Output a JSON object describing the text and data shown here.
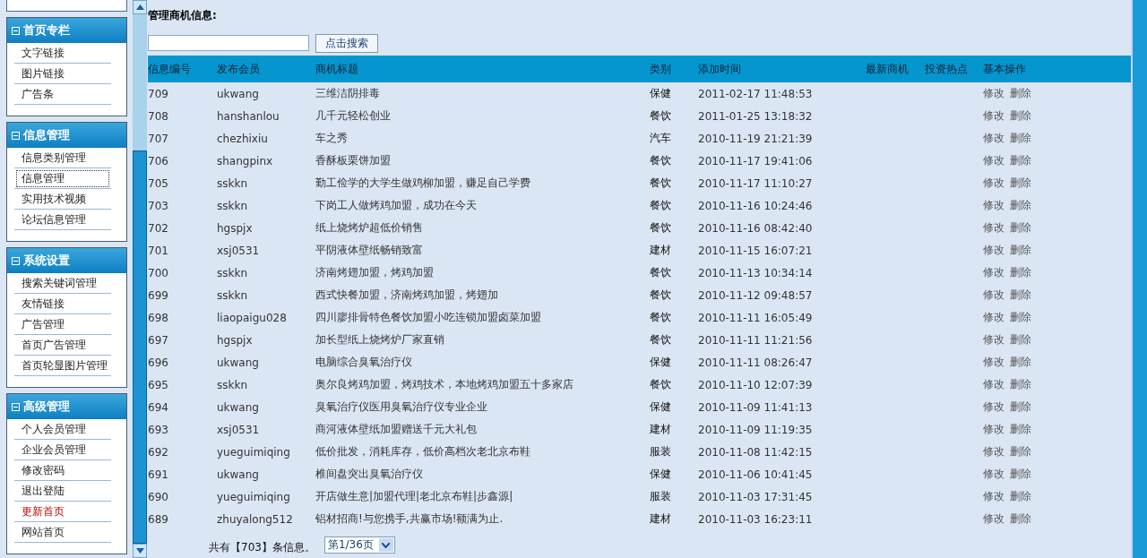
{
  "sidebar": {
    "sections": [
      {
        "title": "首页专栏",
        "items": [
          {
            "label": "文字链接",
            "focused": false,
            "emphasized": false
          },
          {
            "label": "图片链接",
            "focused": false,
            "emphasized": false
          },
          {
            "label": "广告条",
            "focused": false,
            "emphasized": false
          }
        ]
      },
      {
        "title": "信息管理",
        "items": [
          {
            "label": "信息类别管理",
            "focused": false,
            "emphasized": false
          },
          {
            "label": "信息管理",
            "focused": true,
            "emphasized": false
          },
          {
            "label": "实用技术视频",
            "focused": false,
            "emphasized": false
          },
          {
            "label": "论坛信息管理",
            "focused": false,
            "emphasized": false
          }
        ]
      },
      {
        "title": "系统设置",
        "items": [
          {
            "label": "搜索关键词管理",
            "focused": false,
            "emphasized": false
          },
          {
            "label": "友情链接",
            "focused": false,
            "emphasized": false
          },
          {
            "label": "广告管理",
            "focused": false,
            "emphasized": false
          },
          {
            "label": "首页广告管理",
            "focused": false,
            "emphasized": false
          },
          {
            "label": "首页轮显图片管理",
            "focused": false,
            "emphasized": false
          }
        ]
      },
      {
        "title": "高级管理",
        "items": [
          {
            "label": "个人会员管理",
            "focused": false,
            "emphasized": false
          },
          {
            "label": "企业会员管理",
            "focused": false,
            "emphasized": false
          },
          {
            "label": "修改密码",
            "focused": false,
            "emphasized": false
          },
          {
            "label": "退出登陆",
            "focused": false,
            "emphasized": false
          },
          {
            "label": "更新首页",
            "focused": false,
            "emphasized": true
          },
          {
            "label": "网站首页",
            "focused": false,
            "emphasized": false
          }
        ]
      }
    ]
  },
  "page_title": "管理商机信息:",
  "search": {
    "button": "点击搜索"
  },
  "table": {
    "columns": [
      "信息编号",
      "发布会员",
      "商机标题",
      "类别",
      "添加时间",
      "最新商机",
      "投资热点",
      "基本操作"
    ],
    "rows": [
      {
        "id": "709",
        "member": "ukwang",
        "title": "三维洁阴排毒",
        "category": "保健",
        "time": "2011-02-17 11:48:53",
        "actions": [
          "修改",
          "删除"
        ]
      },
      {
        "id": "708",
        "member": "hanshanlou",
        "title": "几千元轻松创业",
        "category": "餐饮",
        "time": "2011-01-25 13:18:32",
        "actions": [
          "修改",
          "删除"
        ]
      },
      {
        "id": "707",
        "member": "chezhixiu",
        "title": "车之秀",
        "category": "汽车",
        "time": "2010-11-19 21:21:39",
        "actions": [
          "修改",
          "删除"
        ]
      },
      {
        "id": "706",
        "member": "shangpinx",
        "title": "香酥板栗饼加盟",
        "category": "餐饮",
        "time": "2010-11-17 19:41:06",
        "actions": [
          "修改",
          "删除"
        ]
      },
      {
        "id": "705",
        "member": "sskkn",
        "title": "勤工俭学的大学生做鸡柳加盟，赚足自己学费",
        "category": "餐饮",
        "time": "2010-11-17 11:10:27",
        "actions": [
          "修改",
          "删除"
        ]
      },
      {
        "id": "703",
        "member": "sskkn",
        "title": "下岗工人做烤鸡加盟，成功在今天",
        "category": "餐饮",
        "time": "2010-11-16 10:24:46",
        "actions": [
          "修改",
          "删除"
        ]
      },
      {
        "id": "702",
        "member": "hgspjx",
        "title": "纸上烧烤炉超低价销售",
        "category": "餐饮",
        "time": "2010-11-16 08:42:40",
        "actions": [
          "修改",
          "删除"
        ]
      },
      {
        "id": "701",
        "member": "xsj0531",
        "title": "平阴液体壁纸畅销致富",
        "category": "建材",
        "time": "2010-11-15 16:07:21",
        "actions": [
          "修改",
          "删除"
        ]
      },
      {
        "id": "700",
        "member": "sskkn",
        "title": "济南烤翅加盟，烤鸡加盟",
        "category": "餐饮",
        "time": "2010-11-13 10:34:14",
        "actions": [
          "修改",
          "删除"
        ]
      },
      {
        "id": "699",
        "member": "sskkn",
        "title": "西式快餐加盟，济南烤鸡加盟，烤翅加",
        "category": "餐饮",
        "time": "2010-11-12 09:48:57",
        "actions": [
          "修改",
          "删除"
        ]
      },
      {
        "id": "698",
        "member": "liaopaigu028",
        "title": "四川廖排骨特色餐饮加盟小吃连锁加盟卤菜加盟",
        "category": "餐饮",
        "time": "2010-11-11 16:05:49",
        "actions": [
          "修改",
          "删除"
        ]
      },
      {
        "id": "697",
        "member": "hgspjx",
        "title": "加长型纸上烧烤炉厂家直销",
        "category": "餐饮",
        "time": "2010-11-11 11:21:56",
        "actions": [
          "修改",
          "删除"
        ]
      },
      {
        "id": "696",
        "member": "ukwang",
        "title": "电脑综合臭氧治疗仪",
        "category": "保健",
        "time": "2010-11-11 08:26:47",
        "actions": [
          "修改",
          "删除"
        ]
      },
      {
        "id": "695",
        "member": "sskkn",
        "title": "奥尔良烤鸡加盟，烤鸡技术，本地烤鸡加盟五十多家店",
        "category": "餐饮",
        "time": "2010-11-10 12:07:39",
        "actions": [
          "修改",
          "删除"
        ]
      },
      {
        "id": "694",
        "member": "ukwang",
        "title": "臭氧治疗仪医用臭氧治疗仪专业企业",
        "category": "保健",
        "time": "2010-11-09 11:41:13",
        "actions": [
          "修改",
          "删除"
        ]
      },
      {
        "id": "693",
        "member": "xsj0531",
        "title": "商河液体壁纸加盟赠送千元大礼包",
        "category": "建材",
        "time": "2010-11-09 11:19:35",
        "actions": [
          "修改",
          "删除"
        ]
      },
      {
        "id": "692",
        "member": "yueguimiqing",
        "title": "低价批发，消耗库存，低价高档次老北京布鞋",
        "category": "服装",
        "time": "2010-11-08 11:42:15",
        "actions": [
          "修改",
          "删除"
        ]
      },
      {
        "id": "691",
        "member": "ukwang",
        "title": "椎间盘突出臭氧治疗仪",
        "category": "保健",
        "time": "2010-11-06 10:41:45",
        "actions": [
          "修改",
          "删除"
        ]
      },
      {
        "id": "690",
        "member": "yueguimiqing",
        "title": "开店做生意|加盟代理|老北京布鞋|步鑫源|",
        "category": "服装",
        "time": "2010-11-03 17:31:45",
        "actions": [
          "修改",
          "删除"
        ]
      },
      {
        "id": "689",
        "member": "zhuyalong512",
        "title": "铝材招商!与您携手,共赢市场!额满为止.",
        "category": "建材",
        "time": "2010-11-03 16:23:11",
        "actions": [
          "修改",
          "删除"
        ]
      }
    ]
  },
  "footer": {
    "total": "共有【703】条信息。",
    "page_select": "第1/36页"
  }
}
